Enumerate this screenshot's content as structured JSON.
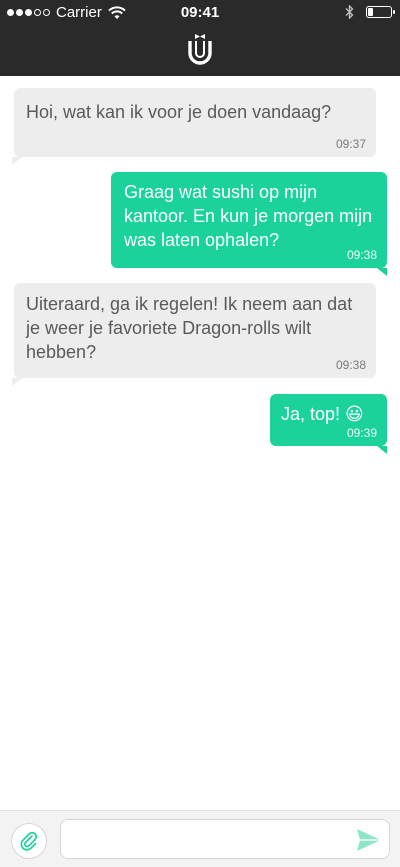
{
  "status_bar": {
    "carrier": "Carrier",
    "time": "09:41"
  },
  "header": {
    "logo_icon": "u-butler-logo"
  },
  "messages": [
    {
      "direction": "incoming",
      "text": "Hoi, wat kan ik voor je doen vandaag?",
      "time": "09:37"
    },
    {
      "direction": "outgoing",
      "text": "Graag wat sushi op mijn kantoor. En kun je morgen mijn was laten ophalen?",
      "time": "09:38"
    },
    {
      "direction": "incoming",
      "text": "Uiteraard, ga ik regelen! Ik neem aan dat je weer je favoriete Dragon-rolls wilt hebben?",
      "time": "09:38"
    },
    {
      "direction": "outgoing",
      "text": "Ja, top! 😃",
      "time": "09:39"
    }
  ],
  "composer": {
    "value": "",
    "placeholder": ""
  },
  "colors": {
    "header_bg": "#2a2a2a",
    "incoming_bubble": "#ecedec",
    "outgoing_bubble": "#1cd29b",
    "accent": "#1cd29b"
  }
}
